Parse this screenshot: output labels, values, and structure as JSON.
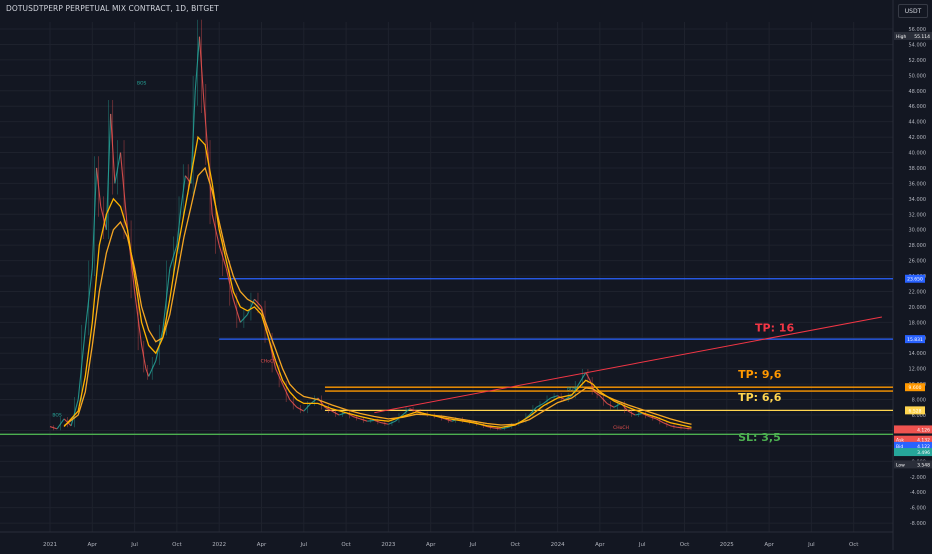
{
  "header": {
    "symbol_title": "DOTUSDTPERP PERPETUAL MIX CONTRACT, 1D, BITGET",
    "currency": "USDT"
  },
  "colors": {
    "background": "#131722",
    "grid": "#1e222d",
    "axis_text": "#b2b5be",
    "ema_fast": "#ffb300",
    "ema_slow": "#f5a623",
    "candle_up": "#26a69a",
    "candle_down": "#ef5350",
    "level_blue": "#2962ff",
    "level_orange": "#ff9800",
    "level_yellow": "#ffd54f",
    "level_green": "#4caf50",
    "trend_red": "#f23645",
    "tp16_text": "#f23645",
    "tp96_text": "#ff9800",
    "tp66_text": "#ffd54f",
    "sl_text": "#4caf50"
  },
  "chart_data": {
    "type": "line",
    "x_unit": "months since Jan 2021",
    "xlim": [
      -0.8,
      47.5
    ],
    "ylim": [
      -9,
      57
    ],
    "grid": true,
    "x_ticks": [
      {
        "x": 0,
        "label": "2021"
      },
      {
        "x": 3,
        "label": "Apr"
      },
      {
        "x": 6,
        "label": "Jul"
      },
      {
        "x": 9,
        "label": "Oct"
      },
      {
        "x": 12,
        "label": "2022"
      },
      {
        "x": 15,
        "label": "Apr"
      },
      {
        "x": 18,
        "label": "Jul"
      },
      {
        "x": 21,
        "label": "Oct"
      },
      {
        "x": 24,
        "label": "2023"
      },
      {
        "x": 27,
        "label": "Apr"
      },
      {
        "x": 30,
        "label": "Jul"
      },
      {
        "x": 33,
        "label": "Oct"
      },
      {
        "x": 36,
        "label": "2024"
      },
      {
        "x": 39,
        "label": "Apr"
      },
      {
        "x": 42,
        "label": "Jul"
      },
      {
        "x": 45,
        "label": "Oct"
      },
      {
        "x": 48,
        "label": "2025"
      },
      {
        "x": 51,
        "label": "Apr"
      },
      {
        "x": 54,
        "label": "Jul"
      },
      {
        "x": 57,
        "label": "Oct"
      }
    ],
    "y_ticks": [
      "56.000",
      "54.000",
      "52.000",
      "50.000",
      "48.000",
      "46.000",
      "44.000",
      "42.000",
      "40.000",
      "38.000",
      "36.000",
      "34.000",
      "32.000",
      "30.000",
      "28.000",
      "26.000",
      "24.000",
      "22.000",
      "20.000",
      "18.000",
      "16.000",
      "14.000",
      "12.000",
      "10.000",
      "8.000",
      "6.000",
      "4.000",
      "2.000",
      "0.000",
      "-2.000",
      "-4.000",
      "-6.000",
      "-8.000"
    ],
    "price_path": [
      [
        0,
        4.5
      ],
      [
        0.5,
        4.2
      ],
      [
        1,
        5.5
      ],
      [
        1.5,
        4.6
      ],
      [
        2,
        8
      ],
      [
        2.5,
        17
      ],
      [
        3,
        25
      ],
      [
        3.3,
        38
      ],
      [
        3.6,
        33
      ],
      [
        4,
        30
      ],
      [
        4.3,
        45
      ],
      [
        4.6,
        36
      ],
      [
        5,
        40
      ],
      [
        5.5,
        30
      ],
      [
        6,
        22
      ],
      [
        6.5,
        15
      ],
      [
        6.8,
        12
      ],
      [
        7,
        11
      ],
      [
        7.5,
        13
      ],
      [
        8,
        17
      ],
      [
        8.5,
        25
      ],
      [
        9,
        28
      ],
      [
        9.3,
        33
      ],
      [
        9.6,
        37
      ],
      [
        10,
        36
      ],
      [
        10.3,
        48
      ],
      [
        10.6,
        55
      ],
      [
        10.9,
        47
      ],
      [
        11.2,
        40
      ],
      [
        11.5,
        32
      ],
      [
        12,
        28
      ],
      [
        12.5,
        25
      ],
      [
        13,
        21
      ],
      [
        13.5,
        18
      ],
      [
        14,
        19
      ],
      [
        14.5,
        21
      ],
      [
        15,
        20
      ],
      [
        15.5,
        16
      ],
      [
        16,
        12
      ],
      [
        16.5,
        10
      ],
      [
        17,
        8
      ],
      [
        17.5,
        7
      ],
      [
        18,
        6.5
      ],
      [
        18.5,
        7.5
      ],
      [
        19,
        8.2
      ],
      [
        19.5,
        7
      ],
      [
        20,
        6.5
      ],
      [
        20.5,
        6
      ],
      [
        21,
        6.3
      ],
      [
        21.5,
        5.8
      ],
      [
        22,
        5.5
      ],
      [
        22.5,
        5.2
      ],
      [
        23,
        5.3
      ],
      [
        23.5,
        5
      ],
      [
        24,
        4.8
      ],
      [
        24.5,
        5.2
      ],
      [
        25,
        6
      ],
      [
        25.5,
        6.8
      ],
      [
        26,
        6.5
      ],
      [
        26.5,
        6.2
      ],
      [
        27,
        6
      ],
      [
        27.5,
        5.8
      ],
      [
        28,
        5.5
      ],
      [
        28.5,
        5.2
      ],
      [
        29,
        5.5
      ],
      [
        29.5,
        5.2
      ],
      [
        30,
        5
      ],
      [
        30.5,
        4.8
      ],
      [
        31,
        4.5
      ],
      [
        31.5,
        4.3
      ],
      [
        32,
        4.2
      ],
      [
        32.5,
        4.4
      ],
      [
        33,
        4.8
      ],
      [
        33.5,
        5.2
      ],
      [
        34,
        6
      ],
      [
        34.5,
        7
      ],
      [
        35,
        7.5
      ],
      [
        35.5,
        8.2
      ],
      [
        36,
        8.5
      ],
      [
        36.5,
        8
      ],
      [
        37,
        8.5
      ],
      [
        37.5,
        10
      ],
      [
        38,
        11.5
      ],
      [
        38.3,
        10.5
      ],
      [
        38.6,
        9
      ],
      [
        39,
        8.5
      ],
      [
        39.5,
        7.5
      ],
      [
        40,
        7
      ],
      [
        40.5,
        7.5
      ],
      [
        41,
        6.5
      ],
      [
        41.5,
        6
      ],
      [
        42,
        6.2
      ],
      [
        42.5,
        5.8
      ],
      [
        43,
        5.5
      ],
      [
        43.5,
        5
      ],
      [
        44,
        4.6
      ],
      [
        44.5,
        4.4
      ],
      [
        45,
        4.3
      ],
      [
        45.5,
        4.2
      ]
    ],
    "ema_fast_path": [
      [
        1,
        4.5
      ],
      [
        2,
        6.5
      ],
      [
        2.5,
        11
      ],
      [
        3,
        18
      ],
      [
        3.5,
        28
      ],
      [
        4,
        32
      ],
      [
        4.5,
        34
      ],
      [
        5,
        33
      ],
      [
        5.5,
        30
      ],
      [
        6,
        24
      ],
      [
        6.5,
        18
      ],
      [
        7,
        15
      ],
      [
        7.5,
        14
      ],
      [
        8,
        16
      ],
      [
        8.5,
        21
      ],
      [
        9,
        27
      ],
      [
        9.5,
        32
      ],
      [
        10,
        37
      ],
      [
        10.5,
        42
      ],
      [
        11,
        41
      ],
      [
        11.5,
        36
      ],
      [
        12,
        30
      ],
      [
        12.5,
        26
      ],
      [
        13,
        22
      ],
      [
        13.5,
        20
      ],
      [
        14,
        19.5
      ],
      [
        14.5,
        20
      ],
      [
        15,
        19
      ],
      [
        15.5,
        16
      ],
      [
        16,
        13
      ],
      [
        16.5,
        10.5
      ],
      [
        17,
        9
      ],
      [
        17.5,
        8
      ],
      [
        18,
        7.5
      ],
      [
        19,
        7.5
      ],
      [
        20,
        6.8
      ],
      [
        21,
        6.3
      ],
      [
        22,
        5.8
      ],
      [
        23,
        5.4
      ],
      [
        24,
        5.2
      ],
      [
        25,
        5.8
      ],
      [
        26,
        6.4
      ],
      [
        27,
        6
      ],
      [
        28,
        5.6
      ],
      [
        29,
        5.3
      ],
      [
        30,
        5
      ],
      [
        31,
        4.6
      ],
      [
        32,
        4.4
      ],
      [
        33,
        4.7
      ],
      [
        34,
        5.8
      ],
      [
        35,
        7.2
      ],
      [
        36,
        8.2
      ],
      [
        37,
        8.6
      ],
      [
        38,
        10.5
      ],
      [
        38.5,
        10
      ],
      [
        39,
        9
      ],
      [
        40,
        7.8
      ],
      [
        41,
        7
      ],
      [
        42,
        6.3
      ],
      [
        43,
        5.7
      ],
      [
        44,
        5
      ],
      [
        45,
        4.6
      ],
      [
        45.5,
        4.4
      ]
    ],
    "ema_slow_path": [
      [
        1,
        4.6
      ],
      [
        2,
        6
      ],
      [
        2.5,
        9
      ],
      [
        3,
        15
      ],
      [
        3.5,
        22
      ],
      [
        4,
        27
      ],
      [
        4.5,
        30
      ],
      [
        5,
        31
      ],
      [
        5.5,
        29
      ],
      [
        6,
        25
      ],
      [
        6.5,
        20
      ],
      [
        7,
        17
      ],
      [
        7.5,
        15.5
      ],
      [
        8,
        16
      ],
      [
        8.5,
        19
      ],
      [
        9,
        24
      ],
      [
        9.5,
        29
      ],
      [
        10,
        33
      ],
      [
        10.5,
        37
      ],
      [
        11,
        38
      ],
      [
        11.5,
        35
      ],
      [
        12,
        31
      ],
      [
        12.5,
        27
      ],
      [
        13,
        24
      ],
      [
        13.5,
        22
      ],
      [
        14,
        21
      ],
      [
        14.5,
        20.5
      ],
      [
        15,
        19.5
      ],
      [
        15.5,
        17
      ],
      [
        16,
        14.5
      ],
      [
        16.5,
        12
      ],
      [
        17,
        10
      ],
      [
        17.5,
        9
      ],
      [
        18,
        8.4
      ],
      [
        19,
        8
      ],
      [
        20,
        7.3
      ],
      [
        21,
        6.7
      ],
      [
        22,
        6.2
      ],
      [
        23,
        5.8
      ],
      [
        24,
        5.5
      ],
      [
        25,
        5.7
      ],
      [
        26,
        6.1
      ],
      [
        27,
        6
      ],
      [
        28,
        5.8
      ],
      [
        29,
        5.5
      ],
      [
        30,
        5.2
      ],
      [
        31,
        4.9
      ],
      [
        32,
        4.7
      ],
      [
        33,
        4.8
      ],
      [
        34,
        5.4
      ],
      [
        35,
        6.5
      ],
      [
        36,
        7.6
      ],
      [
        37,
        8.2
      ],
      [
        38,
        9.5
      ],
      [
        38.5,
        9.4
      ],
      [
        39,
        8.8
      ],
      [
        40,
        8
      ],
      [
        41,
        7.3
      ],
      [
        42,
        6.7
      ],
      [
        43,
        6.1
      ],
      [
        44,
        5.5
      ],
      [
        45,
        5
      ],
      [
        45.5,
        4.8
      ]
    ],
    "horizontal_levels": [
      {
        "y": 23.65,
        "color": "#2962ff",
        "price_label": "23.650"
      },
      {
        "y": 15.83,
        "color": "#2962ff",
        "price_label": "15.831"
      },
      {
        "y": 9.6,
        "color": "#ff9800",
        "price_label": "9.600"
      },
      {
        "y": 9.1,
        "color": "#ff9800",
        "price_label": ""
      },
      {
        "y": 6.6,
        "color": "#ffd54f",
        "price_label": "6.528"
      },
      {
        "y": 3.5,
        "color": "#4caf50",
        "price_label": ""
      }
    ],
    "trend_line": {
      "from": [
        23,
        6.3
      ],
      "to": [
        59,
        18.7
      ]
    },
    "target_labels": [
      {
        "text": "TP: 16",
        "x": 50,
        "y": 16.8,
        "color": "#f23645"
      },
      {
        "text": "TP: 9,6",
        "x": 48.8,
        "y": 10.8,
        "color": "#ff9800"
      },
      {
        "text": "TP: 6,6",
        "x": 48.8,
        "y": 7.8,
        "color": "#ffd54f"
      },
      {
        "text": "SL: 3,5",
        "x": 48.8,
        "y": 2.6,
        "color": "#4caf50"
      }
    ],
    "annotations": [
      {
        "text": "BOS",
        "x": 6.5,
        "y": 48.8
      },
      {
        "text": "BOS",
        "x": 0.5,
        "y": 5.8
      },
      {
        "text": "CHoCH",
        "x": 15.5,
        "y": 12.8
      },
      {
        "text": "BOS",
        "x": 37,
        "y": 9.2
      },
      {
        "text": "CHoCH",
        "x": 40.5,
        "y": 4.2
      }
    ],
    "price_tags": [
      {
        "label": "High",
        "value": "55.114",
        "y": 55.1
      },
      {
        "label": "",
        "value": "4.126",
        "y": 4.13
      },
      {
        "label": "Ask",
        "value": "4.132",
        "y": 2.8
      },
      {
        "label": "Bid",
        "value": "4.122",
        "y": 2.0
      },
      {
        "label": "",
        "value": "3.496",
        "y": 1.2
      },
      {
        "label": "Low",
        "value": "3.548",
        "y": -0.4
      }
    ]
  }
}
